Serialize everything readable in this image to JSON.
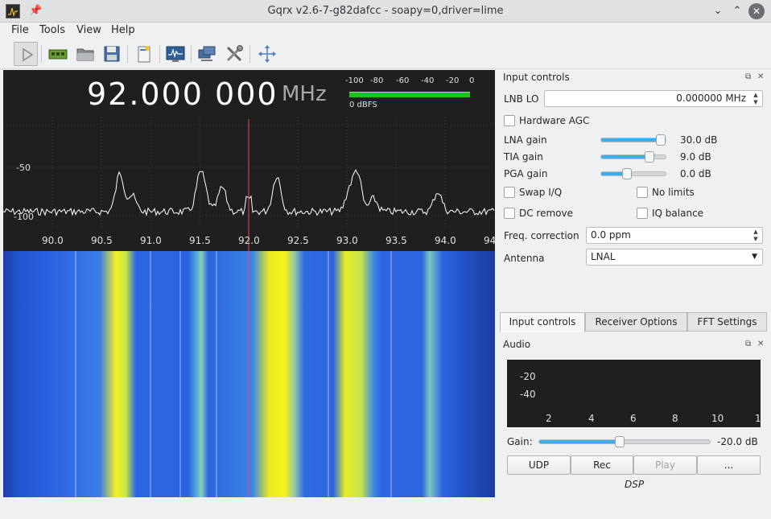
{
  "window": {
    "title": "Gqrx v2.6-7-g82dafcc - soapy=0,driver=lime"
  },
  "menu": [
    "File",
    "Tools",
    "View",
    "Help"
  ],
  "toolbar_icons": [
    "play-icon",
    "hardware-icon",
    "open-folder-icon",
    "save-icon",
    "bookmark-icon",
    "fft-icon",
    "network-icon",
    "tools-icon",
    "fit-icon"
  ],
  "plot": {
    "frequency": "92.000 000",
    "unit": "MHz",
    "meter": {
      "ticks": [
        "-100",
        "-80",
        "-60",
        "-40",
        "-20",
        "0"
      ],
      "label": "0 dBFS",
      "level": 1.0
    },
    "y_labels": [
      "-50",
      "-100"
    ],
    "x_labels": [
      "90.0",
      "90.5",
      "91.0",
      "91.5",
      "92.0",
      "92.5",
      "93.0",
      "93.5",
      "94.0",
      "94"
    ]
  },
  "input_controls": {
    "title": "Input controls",
    "lnb_lo_label": "LNB LO",
    "lnb_lo_value": "0.000000 MHz",
    "hardware_agc": "Hardware AGC",
    "gains": [
      {
        "label": "LNA gain",
        "value": "30.0 dB",
        "level": 0.92
      },
      {
        "label": "TIA gain",
        "value": "9.0 dB",
        "level": 0.75
      },
      {
        "label": "PGA gain",
        "value": "0.0 dB",
        "level": 0.4
      }
    ],
    "swap_iq": "Swap I/Q",
    "no_limits": "No limits",
    "dc_remove": "DC remove",
    "iq_balance": "IQ balance",
    "freq_correction_label": "Freq. correction",
    "freq_correction_value": "0.0 ppm",
    "antenna_label": "Antenna",
    "antenna_value": "LNAL"
  },
  "tabs": [
    "Input controls",
    "Receiver Options",
    "FFT Settings"
  ],
  "audio": {
    "title": "Audio",
    "y_labels": [
      "-20",
      "-40"
    ],
    "x_labels": [
      "2",
      "4",
      "6",
      "8",
      "10",
      "1"
    ],
    "gain_label": "Gain:",
    "gain_value": "-20.0 dB",
    "gain_level": 0.47,
    "buttons": [
      "UDP",
      "Rec",
      "Play",
      "..."
    ],
    "footer": "DSP"
  },
  "colors": {
    "meter_green": "#18c418",
    "accent": "#3daee9",
    "center_line": "#e05050"
  }
}
